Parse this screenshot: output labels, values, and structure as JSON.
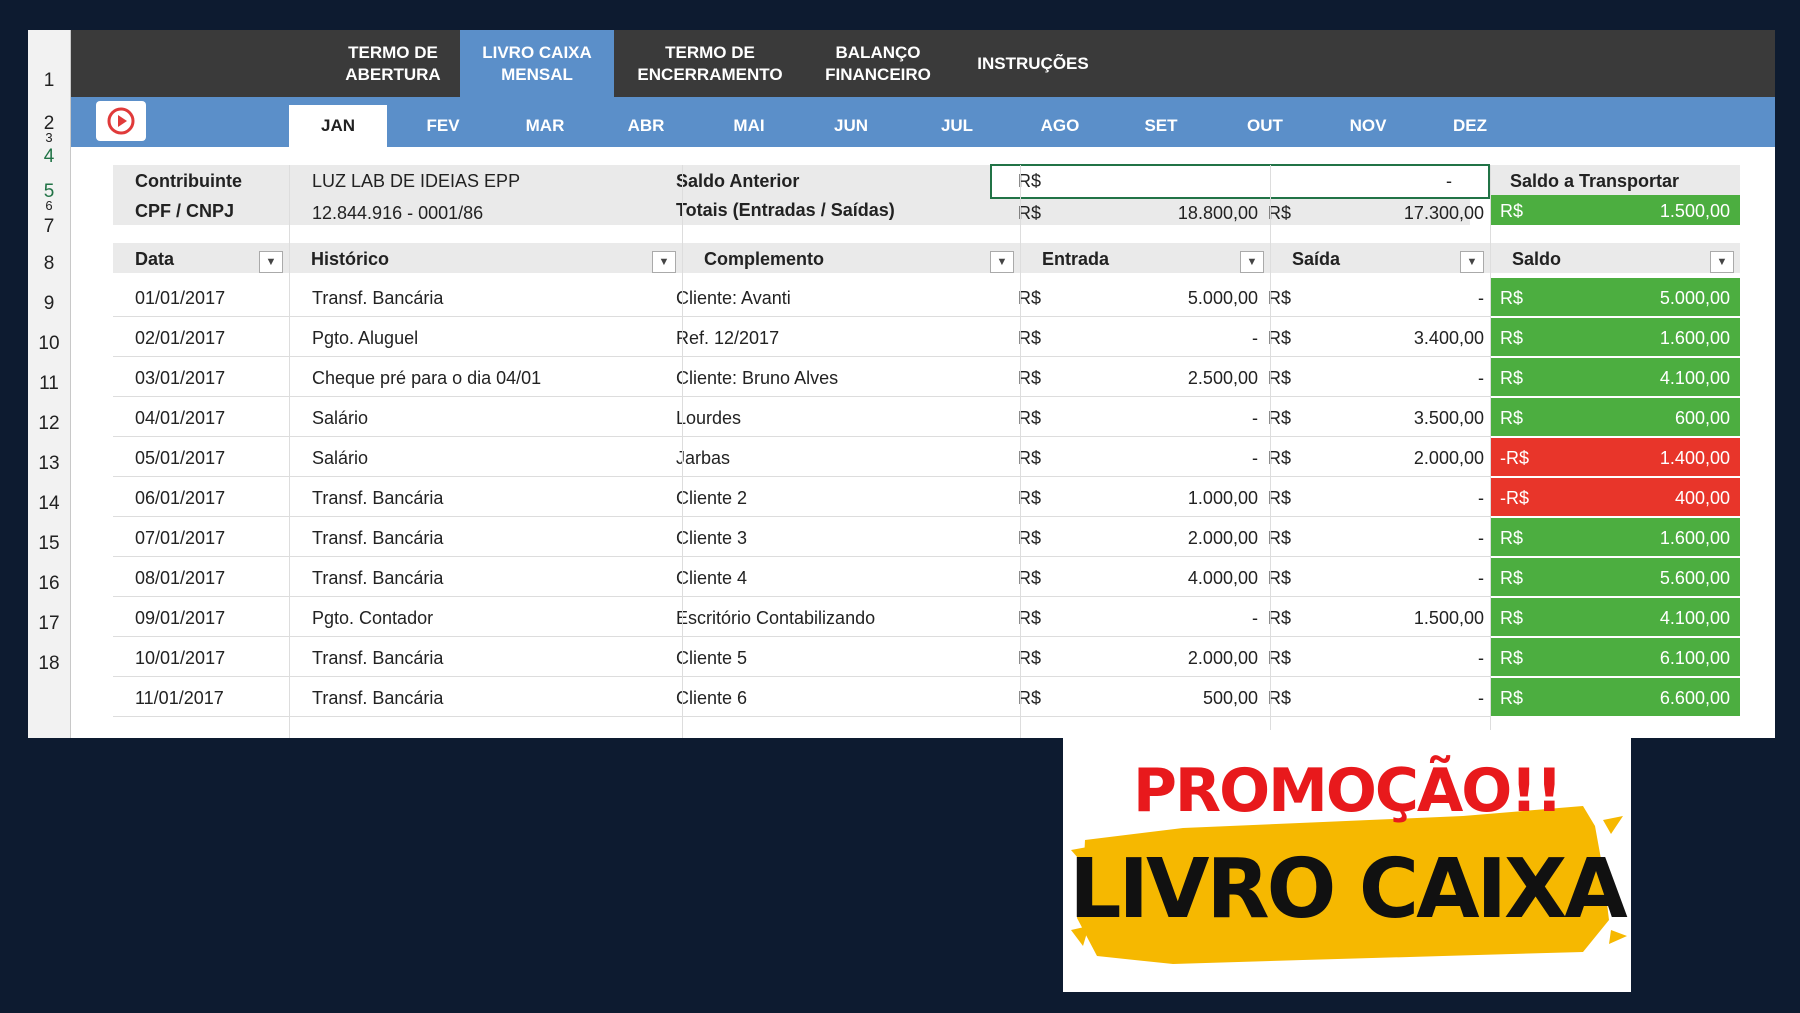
{
  "header": {
    "tabs": [
      {
        "label": "TERMO DE\nABERTURA"
      },
      {
        "label": "LIVRO CAIXA\nMENSAL"
      },
      {
        "label": "TERMO DE\nENCERRAMENTO"
      },
      {
        "label": "BALANÇO\nFINANCEIRO"
      },
      {
        "label": "INSTRUÇÕES"
      }
    ]
  },
  "months": [
    "JAN",
    "FEV",
    "MAR",
    "ABR",
    "MAI",
    "JUN",
    "JUL",
    "AGO",
    "SET",
    "OUT",
    "NOV",
    "DEZ"
  ],
  "rows": [
    "1",
    "2",
    "3",
    "4",
    "5",
    "6",
    "7",
    "8",
    "9",
    "10",
    "11",
    "12",
    "13",
    "14",
    "15",
    "16",
    "17",
    "18"
  ],
  "info": {
    "contribuinte_label": "Contribuinte",
    "contribuinte_value": "LUZ LAB DE IDEIAS EPP",
    "cpf_label": "CPF / CNPJ",
    "cpf_value": "12.844.916 - 0001/86",
    "saldo_anterior_label": "Saldo Anterior",
    "saldo_anterior_currency": "R$",
    "saldo_anterior_value": "-",
    "totais_label": "Totais (Entradas / Saídas)",
    "total_entrada_currency": "R$",
    "total_entrada": "18.800,00",
    "total_saida_currency": "R$",
    "total_saida": "17.300,00",
    "saldo_transportar_label": "Saldo a Transportar",
    "saldo_transportar_currency": "R$",
    "saldo_transportar_value": "1.500,00"
  },
  "table": {
    "headers": [
      "Data",
      "Histórico",
      "Complemento",
      "Entrada",
      "Saída",
      "Saldo"
    ],
    "rows": [
      {
        "data": "01/01/2017",
        "hist": "Transf. Bancária",
        "comp": "Cliente: Avanti",
        "ent_c": "R$",
        "ent": "5.000,00",
        "sai_c": "R$",
        "sai": "-",
        "sal_c": "R$",
        "sal": "5.000,00",
        "neg": false
      },
      {
        "data": "02/01/2017",
        "hist": "Pgto. Aluguel",
        "comp": "Ref. 12/2017",
        "ent_c": "R$",
        "ent": "-",
        "sai_c": "R$",
        "sai": "3.400,00",
        "sal_c": "R$",
        "sal": "1.600,00",
        "neg": false
      },
      {
        "data": "03/01/2017",
        "hist": "Cheque pré para o dia 04/01",
        "comp": "Cliente: Bruno Alves",
        "ent_c": "R$",
        "ent": "2.500,00",
        "sai_c": "R$",
        "sai": "-",
        "sal_c": "R$",
        "sal": "4.100,00",
        "neg": false
      },
      {
        "data": "04/01/2017",
        "hist": "Salário",
        "comp": "Lourdes",
        "ent_c": "R$",
        "ent": "-",
        "sai_c": "R$",
        "sai": "3.500,00",
        "sal_c": "R$",
        "sal": "600,00",
        "neg": false
      },
      {
        "data": "05/01/2017",
        "hist": "Salário",
        "comp": "Jarbas",
        "ent_c": "R$",
        "ent": "-",
        "sai_c": "R$",
        "sai": "2.000,00",
        "sal_c": "-R$",
        "sal": "1.400,00",
        "neg": true
      },
      {
        "data": "06/01/2017",
        "hist": "Transf. Bancária",
        "comp": "Cliente 2",
        "ent_c": "R$",
        "ent": "1.000,00",
        "sai_c": "R$",
        "sai": "-",
        "sal_c": "-R$",
        "sal": "400,00",
        "neg": true
      },
      {
        "data": "07/01/2017",
        "hist": "Transf. Bancária",
        "comp": "Cliente 3",
        "ent_c": "R$",
        "ent": "2.000,00",
        "sai_c": "R$",
        "sai": "-",
        "sal_c": "R$",
        "sal": "1.600,00",
        "neg": false
      },
      {
        "data": "08/01/2017",
        "hist": "Transf. Bancária",
        "comp": "Cliente 4",
        "ent_c": "R$",
        "ent": "4.000,00",
        "sai_c": "R$",
        "sai": "-",
        "sal_c": "R$",
        "sal": "5.600,00",
        "neg": false
      },
      {
        "data": "09/01/2017",
        "hist": "Pgto. Contador",
        "comp": "Escritório Contabilizando",
        "ent_c": "R$",
        "ent": "-",
        "sai_c": "R$",
        "sai": "1.500,00",
        "sal_c": "R$",
        "sal": "4.100,00",
        "neg": false
      },
      {
        "data": "10/01/2017",
        "hist": "Transf. Bancária",
        "comp": "Cliente 5",
        "ent_c": "R$",
        "ent": "2.000,00",
        "sai_c": "R$",
        "sai": "-",
        "sal_c": "R$",
        "sal": "6.100,00",
        "neg": false
      },
      {
        "data": "11/01/2017",
        "hist": "Transf. Bancária",
        "comp": "Cliente 6",
        "ent_c": "R$",
        "ent": "500,00",
        "sai_c": "R$",
        "sai": "-",
        "sal_c": "R$",
        "sal": "6.600,00",
        "neg": false
      }
    ]
  },
  "promo": {
    "headline": "PROMOÇÃO!!",
    "banner": "LIVRO CAIXA"
  },
  "colors": {
    "accent_blue": "#5b8fc9",
    "dark_bar": "#3a3a3a",
    "positive_green": "#4cae40",
    "negative_red": "#e8352a",
    "promo_red": "#e8191c",
    "promo_yellow": "#f6b800"
  },
  "icons": {
    "play": "play-icon",
    "dropdown": "dropdown-icon"
  }
}
